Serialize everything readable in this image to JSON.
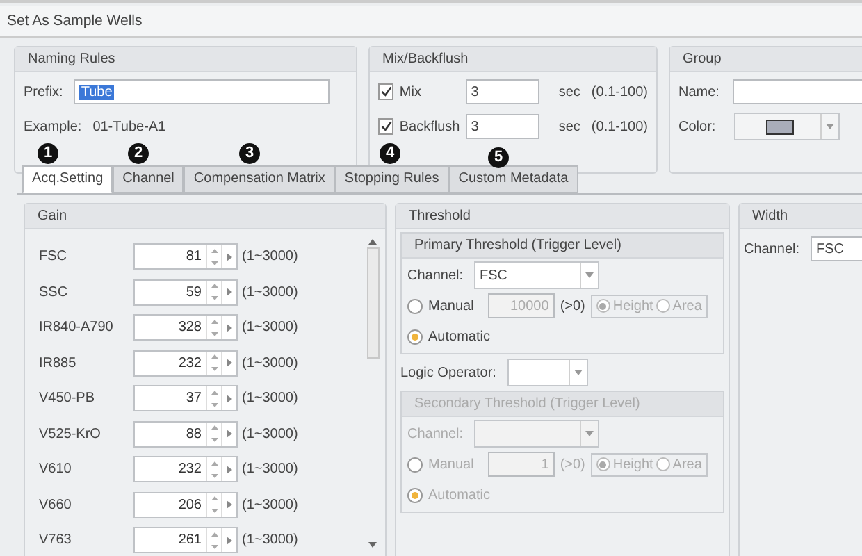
{
  "window": {
    "title": "Set As Sample Wells"
  },
  "naming_rules": {
    "title": "Naming Rules",
    "prefix_label": "Prefix:",
    "prefix_value": "Tube",
    "example_label": "Example:",
    "example_value": "01-Tube-A1"
  },
  "mix_backflush": {
    "title": "Mix/Backflush",
    "rows": [
      {
        "label": "Mix",
        "checked": true,
        "value": "3",
        "unit": "sec",
        "range": "(0.1-100)"
      },
      {
        "label": "Backflush",
        "checked": true,
        "value": "3",
        "unit": "sec",
        "range": "(0.1-100)"
      }
    ]
  },
  "group": {
    "title": "Group",
    "name_label": "Name:",
    "color_label": "Color:",
    "color": "#a9adb9"
  },
  "tabs": [
    {
      "label": "Acq.Setting",
      "selected": true
    },
    {
      "label": "Channel",
      "selected": false
    },
    {
      "label": "Compensation Matrix",
      "selected": false
    },
    {
      "label": "Stopping Rules",
      "selected": false
    },
    {
      "label": "Custom Metadata",
      "selected": false
    }
  ],
  "callouts": [
    {
      "text": "1"
    },
    {
      "text": "2"
    },
    {
      "text": "3"
    },
    {
      "text": "4"
    },
    {
      "text": "5"
    }
  ],
  "gain": {
    "title": "Gain",
    "rows": [
      {
        "name": "FSC",
        "value": "81",
        "range": "(1~3000)"
      },
      {
        "name": "SSC",
        "value": "59",
        "range": "(1~3000)"
      },
      {
        "name": "IR840-A790",
        "value": "328",
        "range": "(1~3000)"
      },
      {
        "name": "IR885",
        "value": "232",
        "range": "(1~3000)"
      },
      {
        "name": "V450-PB",
        "value": "37",
        "range": "(1~3000)"
      },
      {
        "name": "V525-KrO",
        "value": "88",
        "range": "(1~3000)"
      },
      {
        "name": "V610",
        "value": "232",
        "range": "(1~3000)"
      },
      {
        "name": "V660",
        "value": "206",
        "range": "(1~3000)"
      },
      {
        "name": "V763",
        "value": "261",
        "range": "(1~3000)"
      }
    ]
  },
  "threshold": {
    "title": "Threshold",
    "logic_label": "Logic Operator:",
    "sections": [
      {
        "title": "Primary Threshold (Trigger Level)",
        "disabled": false,
        "channel_label": "Channel:",
        "channel": "FSC",
        "manual_label": "Manual",
        "manual_selected": false,
        "manual_value": "10000",
        "hint": "(>0)",
        "height_label": "Height",
        "height_selected": true,
        "area_label": "Area",
        "area_selected": false,
        "auto_label": "Automatic",
        "auto_selected": true
      },
      {
        "title": "Secondary Threshold (Trigger Level)",
        "disabled": true,
        "channel_label": "Channel:",
        "manual_label": "Manual",
        "manual_selected": false,
        "manual_value": "1",
        "hint": "(>0)",
        "height_label": "Height",
        "height_selected": true,
        "area_label": "Area",
        "area_selected": false,
        "auto_label": "Automatic",
        "auto_selected": true
      }
    ]
  },
  "width": {
    "title": "Width",
    "channel_label": "Channel:",
    "channel": "FSC"
  }
}
